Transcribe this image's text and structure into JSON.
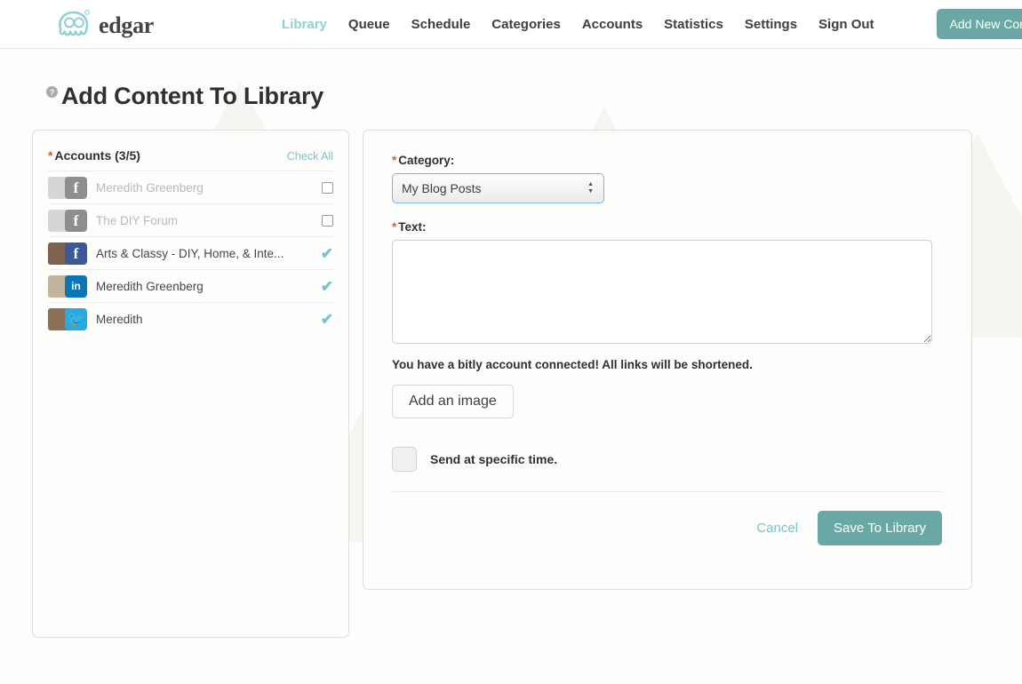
{
  "brand": {
    "name": "edgar",
    "logo_icon": "octopus-glasses-logo",
    "color": "#8fd0d2"
  },
  "nav": {
    "items": [
      {
        "label": "Library",
        "active": true
      },
      {
        "label": "Queue",
        "active": false
      },
      {
        "label": "Schedule",
        "active": false
      },
      {
        "label": "Categories",
        "active": false
      },
      {
        "label": "Accounts",
        "active": false
      },
      {
        "label": "Statistics",
        "active": false
      },
      {
        "label": "Settings",
        "active": false
      },
      {
        "label": "Sign Out",
        "active": false
      }
    ],
    "add_new_content_label": "Add New Content"
  },
  "page": {
    "title": "Add Content To Library",
    "help_icon": "question-mark-icon",
    "help_glyph": "?"
  },
  "accounts_panel": {
    "required_marker": "*",
    "title": "Accounts (3/5)",
    "check_all_label": "Check All",
    "rows": [
      {
        "name": "Meredith Greenberg",
        "network": "facebook",
        "network_glyph": "f",
        "selected": false,
        "muted": true
      },
      {
        "name": "The DIY Forum",
        "network": "facebook",
        "network_glyph": "f",
        "selected": false,
        "muted": true
      },
      {
        "name": "Arts & Classy - DIY, Home, & Inte...",
        "network": "facebook",
        "network_glyph": "f",
        "selected": true,
        "muted": false
      },
      {
        "name": "Meredith Greenberg",
        "network": "linkedin",
        "network_glyph": "in",
        "selected": true,
        "muted": false
      },
      {
        "name": "Meredith",
        "network": "twitter",
        "network_glyph": "🐦",
        "selected": true,
        "muted": false
      }
    ],
    "check_glyph": "✔"
  },
  "form": {
    "category_label": "Category:",
    "category_required": "*",
    "category_value": "My Blog Posts",
    "category_options": [
      "My Blog Posts"
    ],
    "text_label": "Text:",
    "text_required": "*",
    "text_value": "",
    "text_placeholder": "",
    "bitly_note": "You have a bitly account connected! All links will be shortened.",
    "add_image_label": "Add an image",
    "send_specific_time_label": "Send at specific time.",
    "send_specific_time_checked": false,
    "cancel_label": "Cancel",
    "save_label": "Save To Library"
  },
  "colors": {
    "accent_teal": "#6aa8a6",
    "link_teal": "#7cc4c9",
    "required_red": "#c96442",
    "facebook": "#3b5998",
    "linkedin": "#0b76b7",
    "twitter": "#29a9e1"
  }
}
